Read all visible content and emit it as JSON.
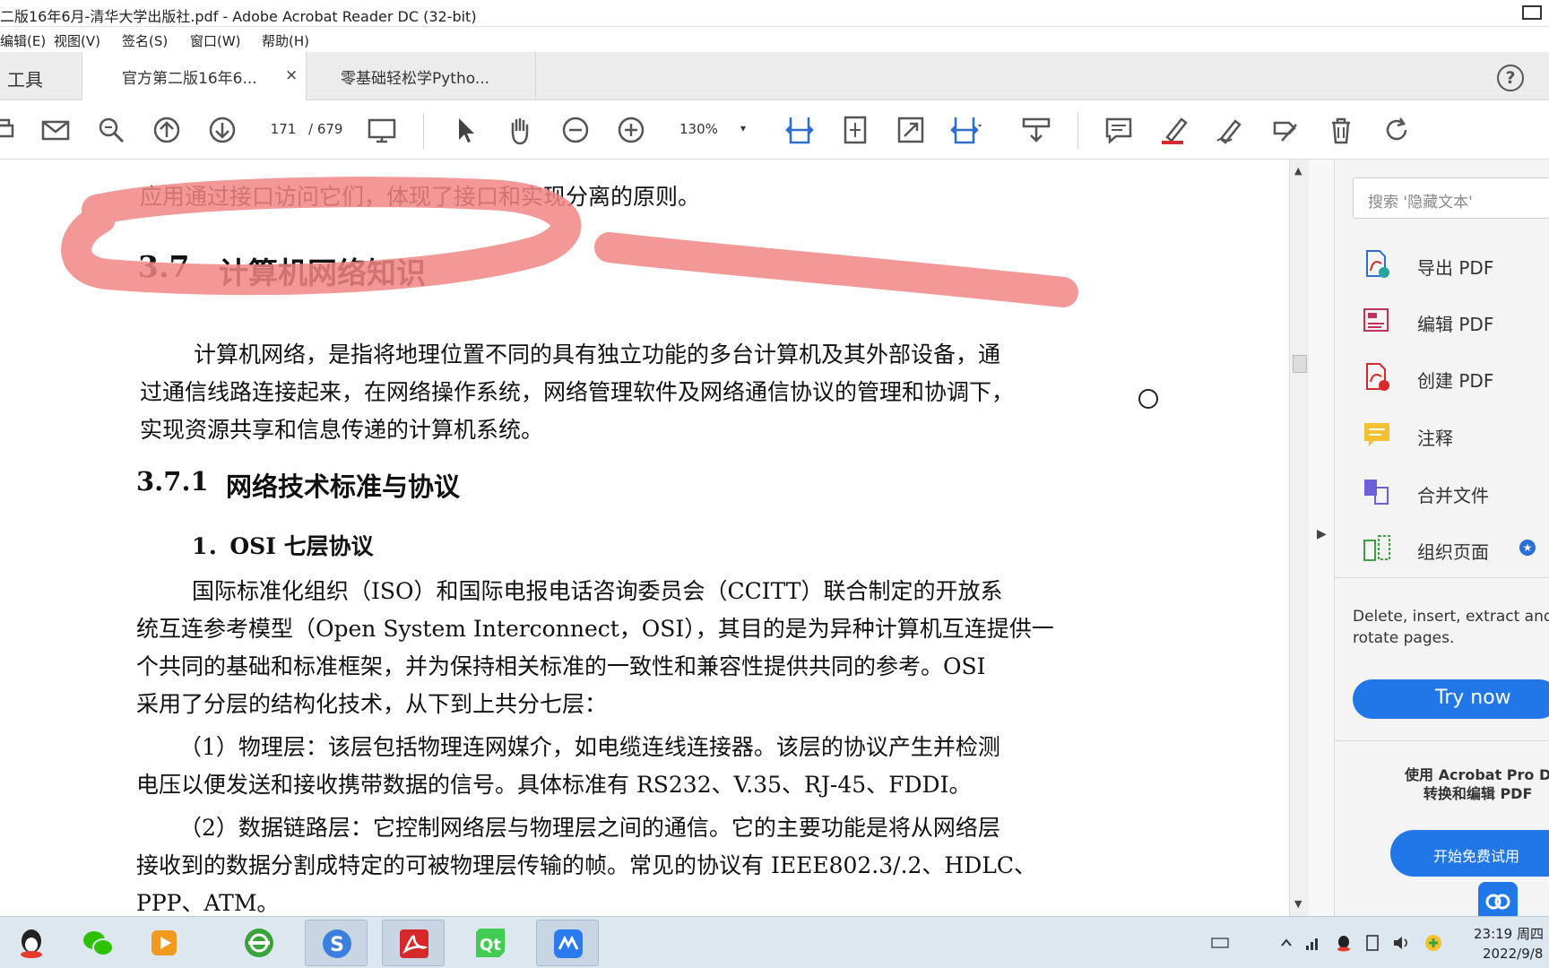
{
  "window": {
    "title": "二版16年6月-清华大学出版社.pdf - Adobe Acrobat Reader DC (32-bit)"
  },
  "menu": {
    "items": [
      "编辑(E)",
      "视图(V)",
      "签名(S)",
      "窗口(W)",
      "帮助(H)"
    ]
  },
  "tabs": {
    "tools": "工具",
    "doc1": "官方第二版16年6...",
    "doc1_close": "×",
    "doc2": "零基础轻松学Pytho..."
  },
  "help_icon": "?",
  "toolbar": {
    "page_current": "171",
    "page_total": "/ 679",
    "zoom": "130%",
    "zoom_dropdown": "▾",
    "icons": [
      "print-icon",
      "email-icon",
      "find-icon",
      "page-up-icon",
      "page-down-icon",
      "page-mode-icon",
      "select-icon",
      "hand-icon",
      "zoom-out-icon",
      "zoom-in-icon",
      "fit-width-icon",
      "fit-page-icon",
      "fullscreen-icon",
      "fit-height-icon",
      "download-icon",
      "comment-icon",
      "highlight-icon",
      "sign-icon",
      "edit-icon",
      "delete-icon",
      "rotate-icon"
    ]
  },
  "document": {
    "line_top": "应用通过接口访问它们，体现了接口和实现分离的原则。",
    "h2_num": "3.7",
    "h2_title": "计算机网络知识",
    "p1_l1": "计算机网络，是指将地理位置不同的具有独立功能的多台计算机及其外部设备，通",
    "p1_l2": "过通信线路连接起来，在网络操作系统，网络管理软件及网络通信协议的管理和协调下，",
    "p1_l3": "实现资源共享和信息传递的计算机系统。",
    "h3_num": "3.7.1",
    "h3_title": "网络技术标准与协议",
    "h4": "1．OSI 七层协议",
    "p2_l1": "国际标准化组织（ISO）和国际电报电话咨询委员会（CCITT）联合制定的开放系",
    "p2_l2": "统互连参考模型（Open System Interconnect，OSI），其目的是为异种计算机互连提供一",
    "p2_l3": "个共同的基础和标准框架，并为保持相关标准的一致性和兼容性提供共同的参考。OSI",
    "p2_l4": "采用了分层的结构化技术，从下到上共分七层：",
    "p3_l1": "（1）物理层：该层包括物理连网媒介，如电缆连线连接器。该层的协议产生并检测",
    "p3_l2": "电压以便发送和接收携带数据的信号。具体标准有 RS232、V.35、RJ-45、FDDI。",
    "p4_l1": "（2）数据链路层：它控制网络层与物理层之间的通信。它的主要功能是将从网络层",
    "p4_l2": "接收到的数据分割成特定的可被物理层传输的帧。常见的协议有 IEEE802.3/.2、HDLC、",
    "p4_l3": "PPP、ATM。"
  },
  "annotation": {
    "color": "#f28585"
  },
  "right_pane": {
    "search_placeholder": "搜索 '隐藏文本'",
    "items": [
      {
        "label": "导出 PDF",
        "icon": "export-pdf-icon"
      },
      {
        "label": "编辑 PDF",
        "icon": "edit-pdf-icon"
      },
      {
        "label": "创建 PDF",
        "icon": "create-pdf-icon"
      },
      {
        "label": "注释",
        "icon": "comment-tool-icon"
      },
      {
        "label": "合并文件",
        "icon": "combine-files-icon"
      },
      {
        "label": "组织页面",
        "icon": "organize-pages-icon"
      }
    ],
    "promo_line1": "Delete, insert, extract and",
    "promo_line2": "rotate pages.",
    "try_now": "Try now",
    "pro_line1": "使用 Acrobat Pro D",
    "pro_line2": "转换和编辑 PDF",
    "free_trial": "开始免费试用"
  },
  "taskbar": {
    "apps": [
      "qq-icon",
      "wechat-icon",
      "media-player-icon",
      "browser-icon",
      "sogou-icon",
      "acrobat-icon",
      "qt-icon",
      "tencent-meeting-icon"
    ],
    "time": "23:19 周四",
    "date": "2022/9/8"
  },
  "colors": {
    "accent_blue": "#2277e8",
    "acrobat_red": "#d7282c",
    "toolbar_blue": "#2c6fd1"
  }
}
